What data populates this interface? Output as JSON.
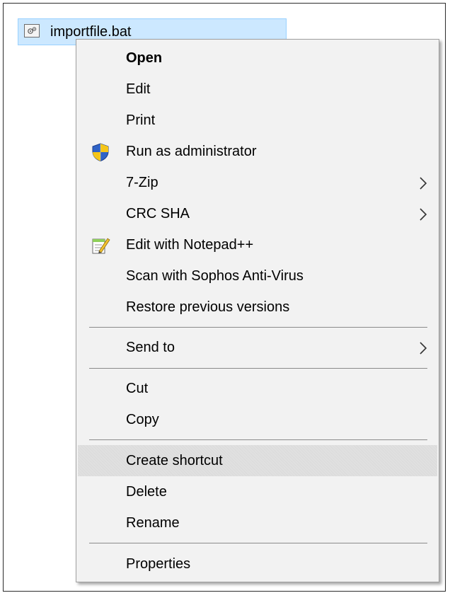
{
  "file": {
    "name": "importfile.bat",
    "icon": "batch-file-icon"
  },
  "menu": {
    "items": [
      {
        "label": "Open",
        "bold": true
      },
      {
        "label": "Edit"
      },
      {
        "label": "Print"
      },
      {
        "label": "Run as administrator",
        "icon": "uac-shield-icon"
      },
      {
        "label": "7-Zip",
        "submenu": true
      },
      {
        "label": "CRC SHA",
        "submenu": true
      },
      {
        "label": "Edit with Notepad++",
        "icon": "notepad-plus-plus-icon"
      },
      {
        "label": "Scan with Sophos Anti-Virus"
      },
      {
        "label": "Restore previous versions"
      },
      {
        "label": "Send to",
        "submenu": true
      },
      {
        "label": "Cut"
      },
      {
        "label": "Copy"
      },
      {
        "label": "Create shortcut",
        "highlighted": true
      },
      {
        "label": "Delete"
      },
      {
        "label": "Rename"
      },
      {
        "label": "Properties"
      }
    ]
  },
  "colors": {
    "selection": "#cce8ff",
    "menu_background": "#f2f2f2",
    "hover": "#e0e0e0"
  }
}
